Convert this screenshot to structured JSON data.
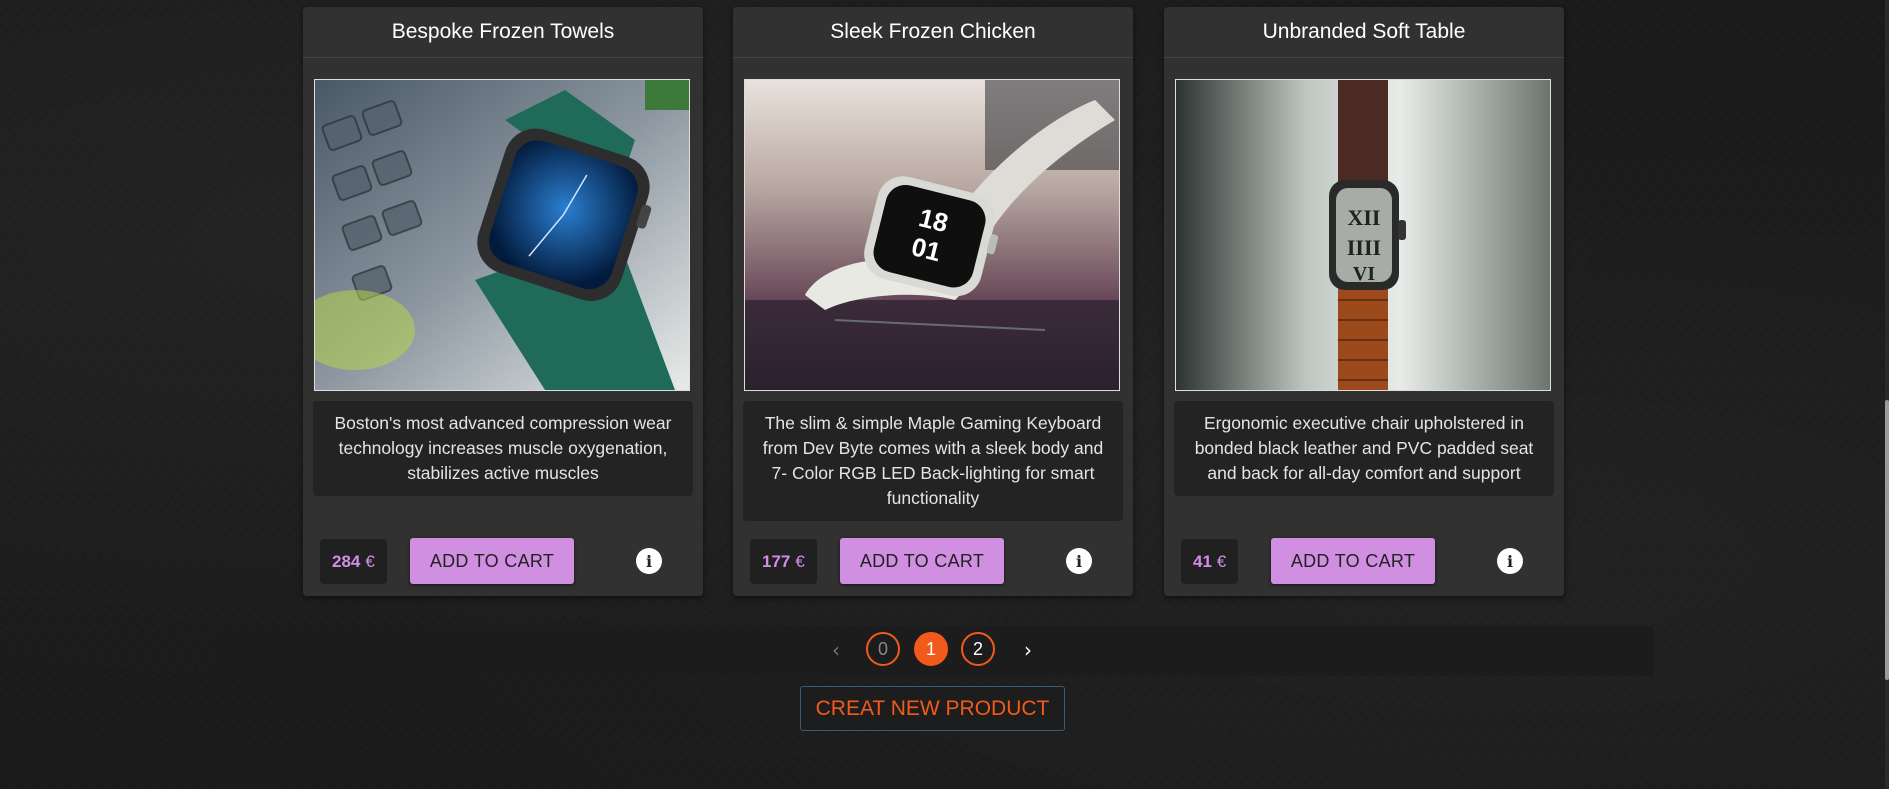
{
  "products": [
    {
      "title": "Bespoke Frozen Towels",
      "description": "Boston's most advanced compression wear technology increases muscle oxygenation, stabilizes active muscles",
      "price": "284",
      "currency": "€",
      "image_alt": "green leather smartwatch"
    },
    {
      "title": "Sleek Frozen Chicken",
      "description": "The slim & simple Maple Gaming Keyboard from Dev Byte comes with a sleek body and 7- Color RGB LED Back-lighting for smart functionality",
      "price": "177",
      "currency": "€",
      "image_alt": "white sport band smartwatch"
    },
    {
      "title": "Unbranded Soft Table",
      "description": "Ergonomic executive chair upholstered in bonded black leather and PVC padded seat and back for all-day comfort and support",
      "price": "41",
      "currency": "€",
      "image_alt": "orange band smartwatch"
    }
  ],
  "labels": {
    "add_to_cart": "ADD TO CART",
    "info": "i",
    "create_product": "CREAT NEW PRODUCT"
  },
  "pagination": {
    "prev": "‹",
    "next": "›",
    "pages": [
      "0",
      "1",
      "2"
    ],
    "current": "1"
  },
  "watch_faces": {
    "card2_time_hour": "18",
    "card2_time_min": "01"
  },
  "colors": {
    "accent_orange": "#f25a1c",
    "button_purple": "#d08fe1",
    "price_purple": "#d28ee6",
    "card_bg": "#313131"
  }
}
